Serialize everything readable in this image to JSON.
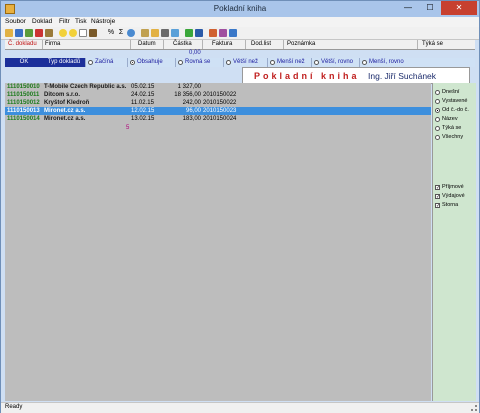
{
  "window": {
    "title": "Pokladní kniha",
    "min_glyph": "—",
    "max_glyph": "☐",
    "close_glyph": "✕"
  },
  "menu": [
    {
      "label": "Soubor"
    },
    {
      "label": "Doklad"
    },
    {
      "label": "Filtr"
    },
    {
      "label": "Tisk"
    },
    {
      "label": "Nástroje"
    }
  ],
  "toolbar": {
    "icons": [
      "folder-icon",
      "floppy-icon",
      "grid-icon",
      "calendar-icon",
      "edit-icon",
      "smiley-icon",
      "face-icon",
      "doc-icon",
      "filter-icon",
      "percent-icon",
      "sigma-icon",
      "refresh-icon",
      "copy-icon",
      "notes-icon",
      "print-icon",
      "preview-icon",
      "upload-icon",
      "save-icon",
      "tools-icon",
      "swap-icon",
      "help-icon"
    ],
    "percent_label": "%",
    "sigma_label": "Σ"
  },
  "table": {
    "columns": [
      "Č. dokladu",
      "Firma",
      "Datum",
      "Částka",
      "Faktura",
      "Dod.list",
      "Poznámka",
      "Týká se"
    ],
    "sum_value": "0,00",
    "rows": [
      {
        "doc": "1110150010",
        "firm": "T-Mobile Czech Republic a.s.",
        "date": "05.02.15",
        "amount": "1 327,00",
        "invoice": "",
        "selected": false
      },
      {
        "doc": "1110150011",
        "firm": "Ditcom s.r.o.",
        "date": "24.02.15",
        "amount": "18 356,00",
        "invoice": "2010150022",
        "selected": false
      },
      {
        "doc": "1110150012",
        "firm": "Kryštof Kledroň",
        "date": "11.02.15",
        "amount": "242,00",
        "invoice": "2010150022",
        "selected": false
      },
      {
        "doc": "1110150013",
        "firm": "Mironet.cz a.s.",
        "date": "12.02.15",
        "amount": "96,00",
        "invoice": "2010150023",
        "selected": true
      },
      {
        "doc": "1110150014",
        "firm": "Mironet.cz a.s.",
        "date": "13.02.15",
        "amount": "183,00",
        "invoice": "2010150024",
        "selected": false
      }
    ],
    "row_count": "5"
  },
  "filters": {
    "ok_label": "OK",
    "type_label": "Typ dokladů",
    "options": [
      {
        "label": "Začíná",
        "selected": false
      },
      {
        "label": "Obsahuje",
        "selected": true
      },
      {
        "label": "Rovná se",
        "selected": false
      },
      {
        "label": "Větší než",
        "selected": false
      },
      {
        "label": "Menší než",
        "selected": false
      },
      {
        "label": "Větší, rovno",
        "selected": false
      },
      {
        "label": "Menší, rovno",
        "selected": false
      }
    ]
  },
  "banner": {
    "title": "Pokladní kniha",
    "owner": "Ing. Jiří Suchánek"
  },
  "right_panel": {
    "periods": [
      {
        "label": "Dnešní",
        "selected": false
      },
      {
        "label": "Vystavené",
        "selected": false
      },
      {
        "label": "Od č.-do č.",
        "selected": true
      },
      {
        "label": "Název",
        "selected": false
      },
      {
        "label": "Týká se",
        "selected": false
      },
      {
        "label": "Všechny",
        "selected": false
      }
    ],
    "checks": [
      {
        "label": "Příjmové",
        "checked": true
      },
      {
        "label": "Výdajové",
        "checked": true
      },
      {
        "label": "Storna",
        "checked": true
      }
    ]
  },
  "status": {
    "text": "Ready"
  }
}
